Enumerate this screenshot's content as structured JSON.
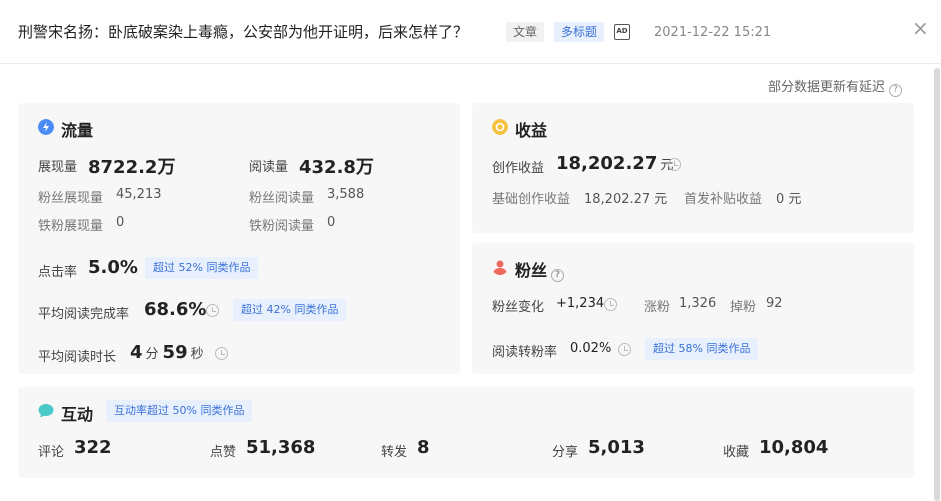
{
  "header": {
    "title": "刑警宋名扬：卧底破案染上毒瘾，公安部为他开证明，后来怎样了？",
    "tag_article": "文章",
    "tag_multi": "多标题",
    "ad_icon": "AD",
    "date": "2021-12-22 15:21",
    "close": "×"
  },
  "note": {
    "delay": "部分数据更新有延迟",
    "help": "?"
  },
  "traffic": {
    "title": "流量",
    "impressions_label": "展现量",
    "impressions_value": "8722.2万",
    "reads_label": "阅读量",
    "reads_value": "432.8万",
    "fan_impr_label": "粉丝展现量",
    "fan_impr_value": "45,213",
    "fan_reads_label": "粉丝阅读量",
    "fan_reads_value": "3,588",
    "iron_impr_label": "铁粉展现量",
    "iron_impr_value": "0",
    "iron_reads_label": "铁粉阅读量",
    "iron_reads_value": "0",
    "ctr_label": "点击率",
    "ctr_value": "5.0%",
    "ctr_badge": "超过 52% 同类作品",
    "completion_label": "平均阅读完成率",
    "completion_value": "68.6%",
    "completion_badge": "超过 42% 同类作品",
    "duration_label": "平均阅读时长",
    "duration_min": "4",
    "duration_min_unit": "分",
    "duration_sec": "59",
    "duration_sec_unit": "秒"
  },
  "income": {
    "title": "收益",
    "creation_label": "创作收益",
    "creation_value": "18,202.27",
    "creation_unit": "元",
    "base_label": "基础创作收益",
    "base_value": "18,202.27 元",
    "first_label": "首发补贴收益",
    "first_value": "0 元"
  },
  "fans": {
    "title": "粉丝",
    "change_label": "粉丝变化",
    "change_value": "+1,234",
    "gain_label": "涨粉",
    "gain_value": "1,326",
    "loss_label": "掉粉",
    "loss_value": "92",
    "convert_label": "阅读转粉率",
    "convert_value": "0.02%",
    "convert_badge": "超过 58% 同类作品"
  },
  "interaction": {
    "title": "互动",
    "badge": "互动率超过 50% 同类作品",
    "comments_label": "评论",
    "comments_value": "322",
    "likes_label": "点赞",
    "likes_value": "51,368",
    "shares_label": "转发",
    "shares_value": "8",
    "share2_label": "分享",
    "share2_value": "5,013",
    "fav_label": "收藏",
    "fav_value": "10,804"
  },
  "colors": {
    "accent": "#3a72d8",
    "traffic_icon": "#4a8cf5",
    "income_icon": "#f5c242",
    "fans_icon": "#ef6a5d",
    "interaction_icon": "#4bc8c8"
  }
}
